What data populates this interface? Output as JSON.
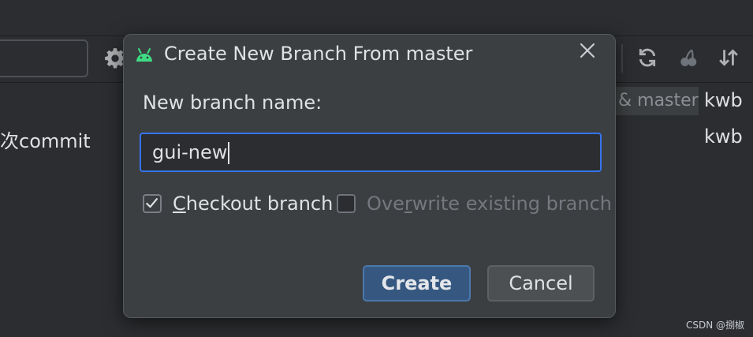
{
  "background": {
    "branch_tag": "& master",
    "author_1": "kwb",
    "commit_message": "次commit",
    "author_2": "kwb",
    "toolbar_icons": [
      "gear-icon",
      "refresh-icon",
      "cherry-pick-icon",
      "sort-icon"
    ]
  },
  "dialog": {
    "title": "Create New Branch From master",
    "title_icon": "android-icon",
    "close_icon": "close-icon",
    "branch_name_label": "New branch name:",
    "branch_name_value": "gui-new",
    "checkout": {
      "before": "",
      "mnemonic": "C",
      "after": "heckout branch",
      "checked": true
    },
    "overwrite": {
      "before": "Ove",
      "mnemonic": "r",
      "after": "write existing branch",
      "checked": false
    },
    "create_label": "Create",
    "cancel_label": "Cancel"
  },
  "watermark": "CSDN @捌椒",
  "colors": {
    "background": "#2b2d30",
    "dialog": "#3c3f41",
    "accent": "#3574f0",
    "primary_button": "#365880",
    "android_green": "#3ddc84"
  }
}
